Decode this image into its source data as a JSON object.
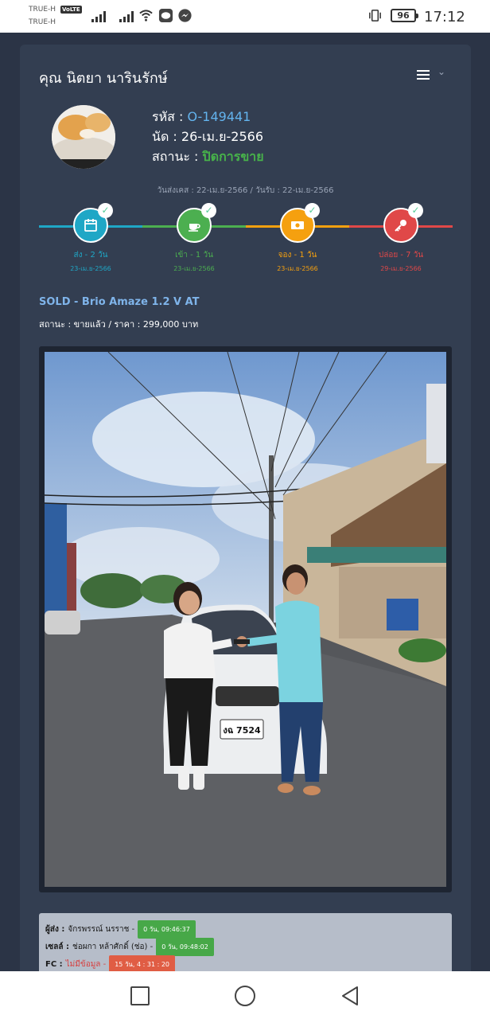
{
  "statusbar": {
    "carrier1": "TRUE-H",
    "carrier2": "TRUE-H",
    "volte": "VoLTE",
    "battery": "96",
    "time": "17:12"
  },
  "page": {
    "customer_name": "คุณ นิตยา นารินรักษ์"
  },
  "profile": {
    "code_label": "รหัส : ",
    "code": "O-149441",
    "appointment": "นัด : 26-เม.ย-2566",
    "status_label": "สถานะ : ",
    "status": "ปิดการขาย"
  },
  "dates": "วันส่งเคส : 22-เม.ย-2566 / วันรับ : 22-เม.ย-2566",
  "timeline": [
    {
      "label": "ส่ง - 2 วัน",
      "date": "23-เม.ย-2566",
      "color": "#1fa7c6",
      "icon": "calendar-icon"
    },
    {
      "label": "เข้า - 1 วัน",
      "date": "23-เม.ย-2566",
      "color": "#4caf50",
      "icon": "coffee-cup-icon"
    },
    {
      "label": "จอง - 1 วัน",
      "date": "23-เม.ย-2566",
      "color": "#f5a00f",
      "icon": "money-icon"
    },
    {
      "label": "ปล่อย - 7 วัน",
      "date": "29-เม.ย-2566",
      "color": "#e04848",
      "icon": "key-icon"
    }
  ],
  "car": {
    "title": "SOLD - Brio Amaze 1.2 V AT",
    "status": "สถานะ : ขายแล้ว / ราคา : 299,000 บาท"
  },
  "photo": {
    "plate": "งฉ 7524"
  },
  "staff": [
    {
      "role": "ผู้ส่ง :",
      "name": "จักรพรรณ์ นรราช -",
      "badge": "0 วัน, 09:46:37",
      "badge_color": "green",
      "name_missing": false
    },
    {
      "role": "เซลล์ :",
      "name": "ช่อผกา หล้าศักดิ์ (ช่อ) -",
      "badge": "0 วัน, 09:48:02",
      "badge_color": "green",
      "name_missing": false
    },
    {
      "role": "FC :",
      "name": "ไม่มีข้อมูล -",
      "badge": "15 วัน, 4 : 31 : 20",
      "badge_color": "red",
      "name_missing": true
    }
  ]
}
